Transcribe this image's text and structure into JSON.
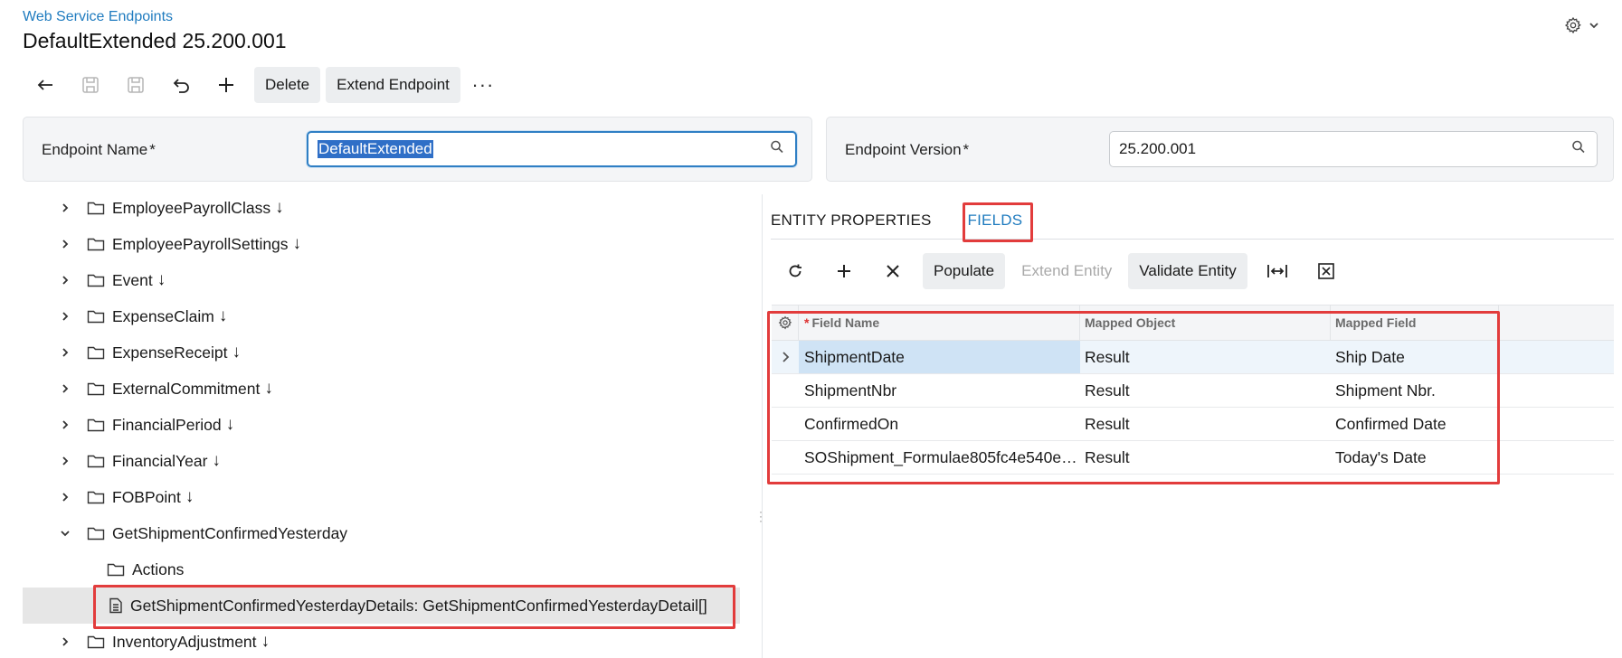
{
  "header": {
    "breadcrumb": "Web Service Endpoints",
    "title": "DefaultExtended 25.200.001",
    "settings_icon": "gear-icon"
  },
  "toolbar": {
    "icons": [
      "back-arrow-icon",
      "save-close-icon",
      "save-icon",
      "undo-icon",
      "add-icon"
    ],
    "delete_label": "Delete",
    "extend_endpoint_label": "Extend Endpoint",
    "more_label": "···"
  },
  "form": {
    "endpoint_name_label": "Endpoint Name",
    "endpoint_name_value": "DefaultExtended",
    "endpoint_version_label": "Endpoint Version",
    "endpoint_version_value": "25.200.001",
    "required_mark": "*"
  },
  "tree": {
    "items": [
      {
        "label": "EmployeePayrollClass",
        "arrow": "↓"
      },
      {
        "label": "EmployeePayrollSettings",
        "arrow": "↓"
      },
      {
        "label": "Event",
        "arrow": "↓"
      },
      {
        "label": "ExpenseClaim",
        "arrow": "↓"
      },
      {
        "label": "ExpenseReceipt",
        "arrow": "↓"
      },
      {
        "label": "ExternalCommitment",
        "arrow": "↓"
      },
      {
        "label": "FinancialPeriod",
        "arrow": "↓"
      },
      {
        "label": "FinancialYear",
        "arrow": "↓"
      },
      {
        "label": "FOBPoint",
        "arrow": "↓"
      },
      {
        "label": "GetShipmentConfirmedYesterday",
        "arrow": ""
      },
      {
        "label": "Actions",
        "arrow": ""
      },
      {
        "label": "GetShipmentConfirmedYesterdayDetails: GetShipmentConfirmedYesterdayDetail[]",
        "arrow": ""
      },
      {
        "label": "InventoryAdjustment",
        "arrow": "↓"
      }
    ]
  },
  "tabs": {
    "entity_properties": "ENTITY PROPERTIES",
    "fields": "FIELDS"
  },
  "grid_toolbar": {
    "populate_label": "Populate",
    "extend_entity_label": "Extend Entity",
    "validate_entity_label": "Validate Entity"
  },
  "grid": {
    "columns": [
      "Field Name",
      "Mapped Object",
      "Mapped Field"
    ],
    "required_mark": "*",
    "rows": [
      {
        "field_name": "ShipmentDate",
        "mapped_object": "Result",
        "mapped_field": "Ship Date"
      },
      {
        "field_name": "ShipmentNbr",
        "mapped_object": "Result",
        "mapped_field": "Shipment Nbr."
      },
      {
        "field_name": "ConfirmedOn",
        "mapped_object": "Result",
        "mapped_field": "Confirmed Date"
      },
      {
        "field_name": "SOShipment_Formulae805fc4e540e…",
        "mapped_object": "Result",
        "mapped_field": "Today's Date"
      }
    ]
  },
  "colors": {
    "accent": "#1f7bbf",
    "highlight_red": "#e23c3c",
    "selection_blue": "#2f6fc7"
  }
}
